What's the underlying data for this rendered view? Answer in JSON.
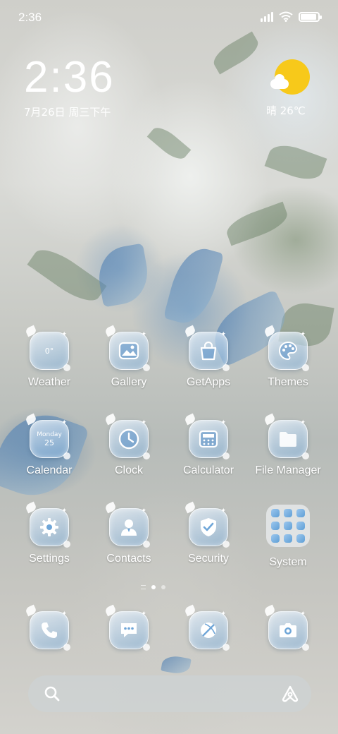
{
  "status_bar": {
    "time": "2:36",
    "battery_level": 0.9,
    "signal_bars": 4
  },
  "clock_widget": {
    "time": "2:36",
    "date": "7月26日 周三下午"
  },
  "weather_widget": {
    "text": "晴 26℃",
    "icon": "sunny-with-cloud"
  },
  "apps": [
    {
      "label": "Weather",
      "icon": "weather-icon",
      "badge": "0°"
    },
    {
      "label": "Gallery",
      "icon": "gallery-icon"
    },
    {
      "label": "GetApps",
      "icon": "shopping-bag-icon"
    },
    {
      "label": "Themes",
      "icon": "palette-icon"
    },
    {
      "label": "Calendar",
      "icon": "calendar-icon",
      "day_name": "Monday",
      "day_num": "25"
    },
    {
      "label": "Clock",
      "icon": "clock-icon"
    },
    {
      "label": "Calculator",
      "icon": "calculator-icon"
    },
    {
      "label": "File Manager",
      "icon": "folder-icon"
    },
    {
      "label": "Settings",
      "icon": "gear-icon"
    },
    {
      "label": "Contacts",
      "icon": "contact-icon"
    },
    {
      "label": "Security",
      "icon": "shield-check-icon"
    },
    {
      "label": "System",
      "icon": "app-folder-icon"
    }
  ],
  "page_indicator": {
    "pages": 2,
    "active": 1
  },
  "dock": [
    {
      "icon": "phone-icon"
    },
    {
      "icon": "message-icon"
    },
    {
      "icon": "browser-icon"
    },
    {
      "icon": "camera-icon"
    }
  ],
  "search_bar": {
    "search_icon": "search-icon",
    "assistant_icon": "assistant-icon"
  },
  "colors": {
    "sun": "#f7c91a",
    "icon_blue": "#5f9fd6"
  }
}
